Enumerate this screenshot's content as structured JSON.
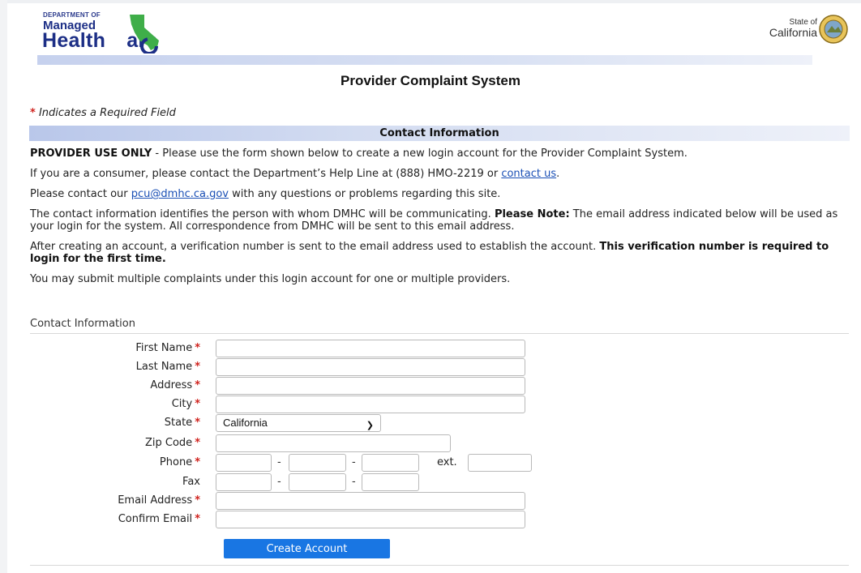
{
  "header": {
    "logo_dept": "DEPARTMENT OF",
    "logo_managed": "Managed",
    "logo_health": "Health",
    "logo_care": "are",
    "state_of": "State of",
    "state_name": "California"
  },
  "page": {
    "title": "Provider Complaint System",
    "required_note": "Indicates a Required Field",
    "section_title": "Contact Information"
  },
  "content": {
    "p1_bold": "PROVIDER USE ONLY",
    "p1_text": " - Please use the form shown below to create a new login account for the Provider Complaint System.",
    "p2_text": "If you are a consumer, please contact the Department’s Help Line at (888) HMO-2219 or ",
    "p2_link": "contact us",
    "p2_end": ".",
    "p3_text": "Please contact our ",
    "p3_link": "pcu@dmhc.ca.gov",
    "p3_end": " with any questions or problems regarding this site.",
    "p4_text": "The contact information identifies the person with whom DMHC will be communicating. ",
    "p4_bold": "Please Note:",
    "p4_end": " The email address indicated below will be used as your login for the system. All correspondence from DMHC will be sent to this email address.",
    "p5_text": "After creating an account, a verification number is sent to the email address used to establish the account. ",
    "p5_bold": "This verification number is required to login for the first time.",
    "p6_text": "You may submit multiple complaints under this login account for one or multiple providers."
  },
  "form": {
    "legend": "Contact Information",
    "first_name": "First Name",
    "last_name": "Last Name",
    "address": "Address",
    "city": "City",
    "state": "State",
    "state_value": "California",
    "zip": "Zip Code",
    "phone": "Phone",
    "ext": "ext.",
    "fax": "Fax",
    "email": "Email Address",
    "confirm_email": "Confirm Email",
    "dash": "-",
    "star": "*",
    "submit": "Create Account"
  },
  "colors": {
    "accent": "#1976e3",
    "required": "#d0231e",
    "link": "#1a4fb5"
  }
}
